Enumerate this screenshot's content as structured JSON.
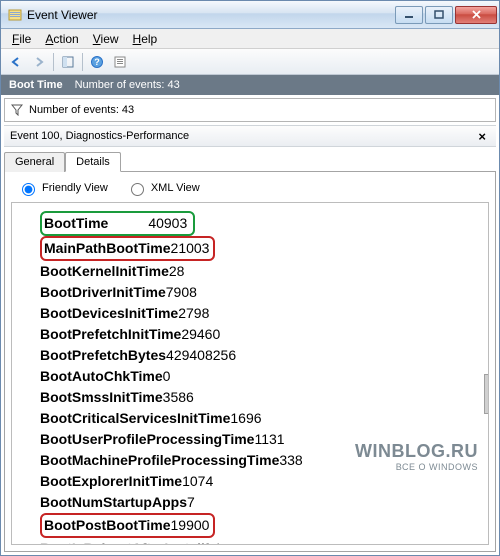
{
  "window": {
    "title": "Event Viewer"
  },
  "menu": {
    "file": "File",
    "action": "Action",
    "view": "View",
    "help": "Help"
  },
  "darkbar": {
    "boot": "Boot Time",
    "events_label": "Number of events: 43"
  },
  "filter": {
    "events_label": "Number of events: 43"
  },
  "eventheader": {
    "text": "Event 100, Diagnostics-Performance",
    "close": "×"
  },
  "tabs": {
    "general": "General",
    "details": "Details"
  },
  "viewmode": {
    "friendly": "Friendly View",
    "xml": "XML View"
  },
  "rows": {
    "r0": {
      "k": "BootTime",
      "v": "40903"
    },
    "r1": {
      "k": "MainPathBootTime",
      "v": "21003"
    },
    "r2": {
      "k": "BootKernelInitTime",
      "v": "28"
    },
    "r3": {
      "k": "BootDriverInitTime",
      "v": "7908"
    },
    "r4": {
      "k": "BootDevicesInitTime",
      "v": "2798"
    },
    "r5": {
      "k": "BootPrefetchInitTime",
      "v": "29460"
    },
    "r6": {
      "k": "BootPrefetchBytes",
      "v": "429408256"
    },
    "r7": {
      "k": "BootAutoChkTime",
      "v": "0"
    },
    "r8": {
      "k": "BootSmssInitTime",
      "v": "3586"
    },
    "r9": {
      "k": "BootCriticalServicesInitTime",
      "v": "1696"
    },
    "r10": {
      "k": "BootUserProfileProcessingTime",
      "v": "1131"
    },
    "r11": {
      "k": "BootMachineProfileProcessingTime",
      "v": "338"
    },
    "r12": {
      "k": "BootExplorerInitTime",
      "v": "1074"
    },
    "r13": {
      "k": "BootNumStartupApps",
      "v": "7"
    },
    "r14": {
      "k": "BootPostBootTime",
      "v": "19900"
    },
    "r15": {
      "k": "BootIsRebootAfterInstall",
      "v": "false"
    }
  },
  "watermark": {
    "big": "WINBLOG.RU",
    "small": "ВСЕ О WINDOWS"
  }
}
